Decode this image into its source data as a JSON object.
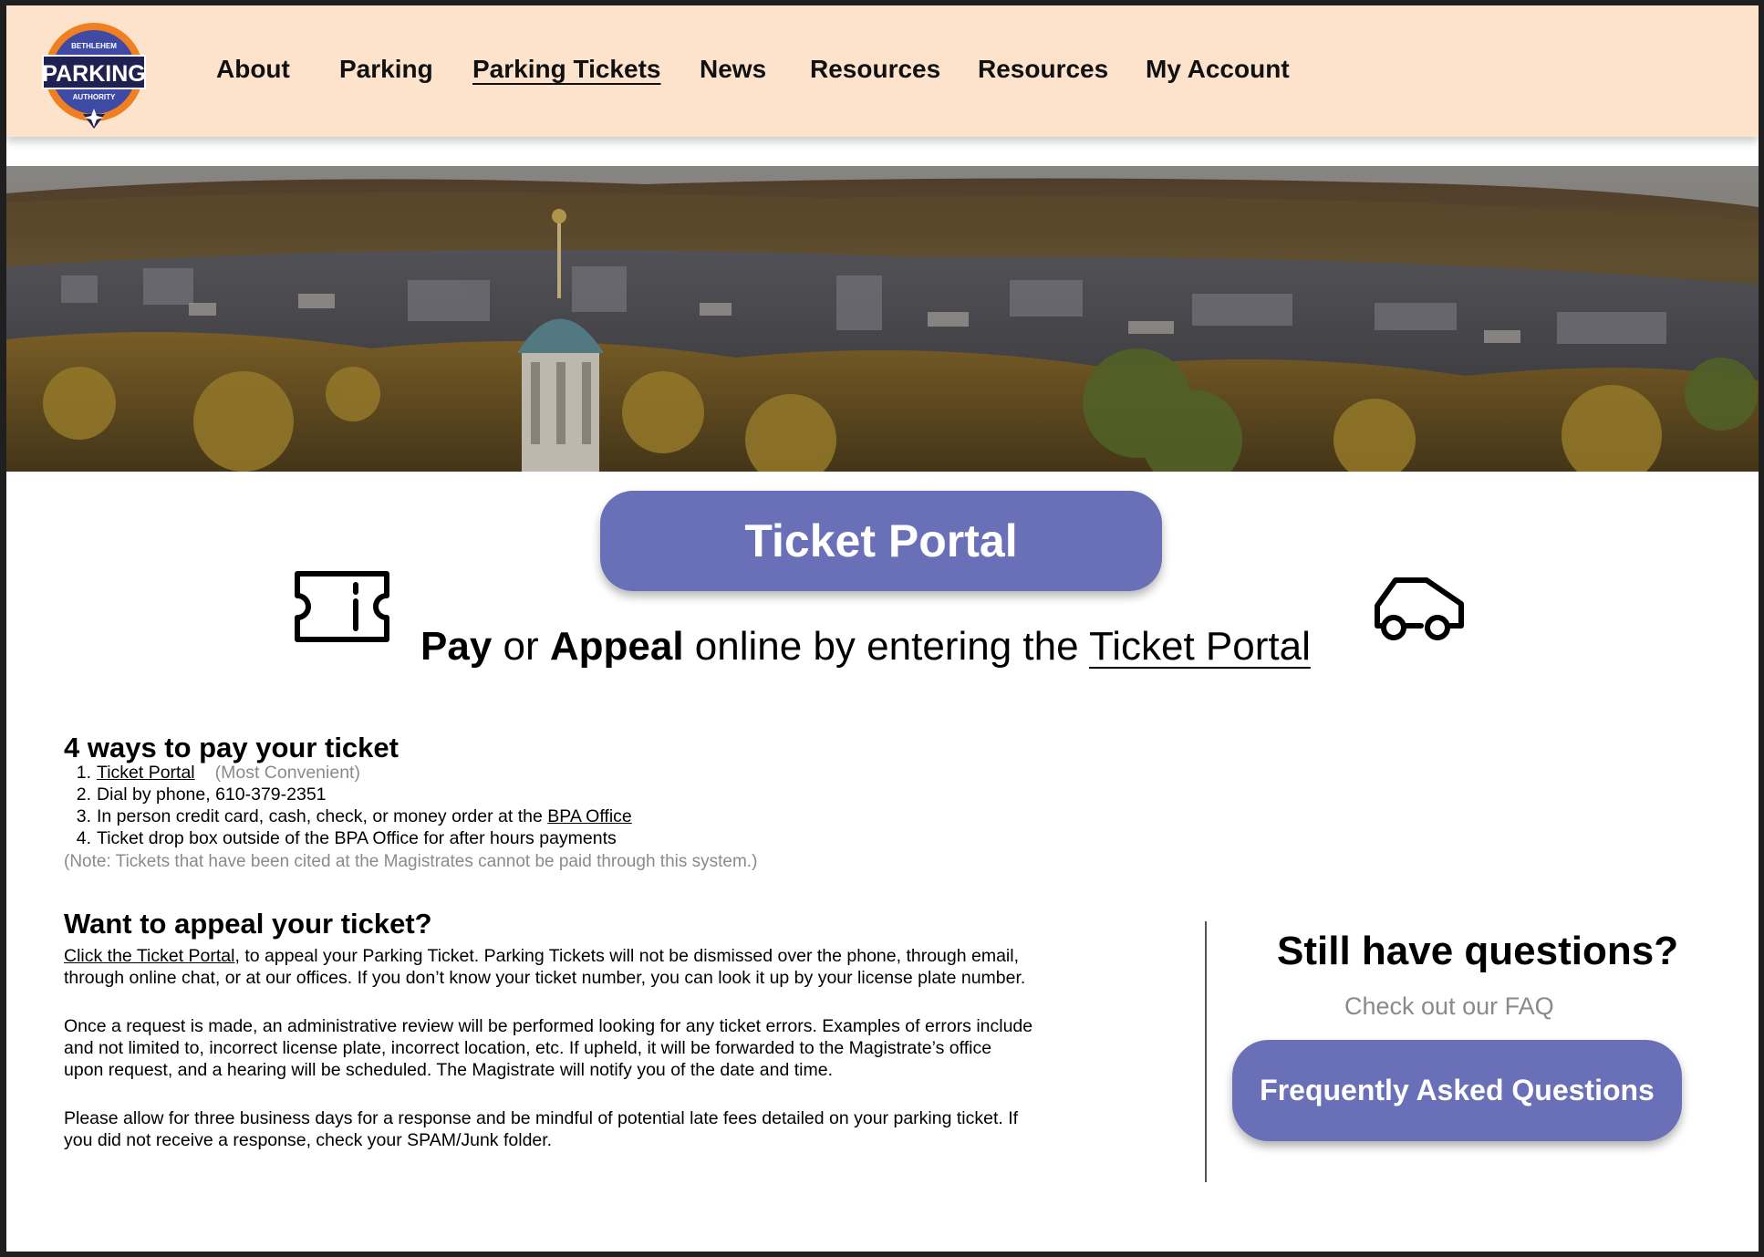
{
  "header": {
    "logo": {
      "top_text": "BETHLEHEM",
      "main_text": "PARKING",
      "bottom_text": "AUTHORITY"
    },
    "nav": [
      {
        "label": "About"
      },
      {
        "label": "Parking"
      },
      {
        "label": "Parking Tickets",
        "active": true
      },
      {
        "label": "News"
      },
      {
        "label": "Resources"
      },
      {
        "label": "Resources"
      },
      {
        "label": "My Account"
      }
    ]
  },
  "hero": {
    "image": "Bethlehem cityscape with autumn hills"
  },
  "portal": {
    "button_label": "Ticket Portal",
    "tagline_pay": "Pay",
    "tagline_or": " or ",
    "tagline_appeal": "Appeal",
    "tagline_mid": " online by entering the ",
    "tagline_link": "Ticket Portal",
    "left_icon": "ticket-icon",
    "right_icon": "car-icon"
  },
  "ways": {
    "heading": "4 ways to pay your ticket",
    "item1_link": "Ticket Portal",
    "item1_note": "(Most Convenient)",
    "item2": "Dial by phone, 610-379-2351",
    "item3_text": "In person credit card, cash, check, or money order at the ",
    "item3_link": "BPA Office",
    "item4": "Ticket drop box outside of the BPA Office for after hours payments",
    "note": "(Note: Tickets that have been cited at the Magistrates cannot be paid through this system.)"
  },
  "appeal": {
    "heading": "Want to appeal your ticket?",
    "p1_link": "Click the Ticket Portal",
    "p1_line1": ", to appeal your Parking Ticket. Parking Tickets will not be dismissed over the phone, through email,",
    "p1_line2": "through online chat, or at our offices. If you don’t know your ticket number, you can look it up by your license plate number.",
    "p2_line1": "Once a request is made, an administrative review will be performed looking for any ticket errors. Examples of errors include",
    "p2_line2": "and not limited to, incorrect license plate, incorrect location, etc. If upheld, it will be forwarded to the Magistrate’s office",
    "p2_line3": "upon request, and a hearing will be scheduled. The Magistrate will notify you of the date and time.",
    "p3_line1": "Please allow for three business days for a response and be mindful of potential late fees detailed on your parking ticket. If",
    "p3_line2": "you did not receive a response, check your SPAM/Junk folder."
  },
  "side": {
    "title": "Still have questions?",
    "subtitle": "Check out our FAQ",
    "button_label": "Frequently Asked Questions"
  },
  "colors": {
    "header_bg": "#fde3cb",
    "button": "#6a70b8",
    "muted": "#8a8a8a",
    "logo_orange": "#f07f22",
    "logo_navy": "#1e2152",
    "logo_blue": "#3f4aa5"
  }
}
